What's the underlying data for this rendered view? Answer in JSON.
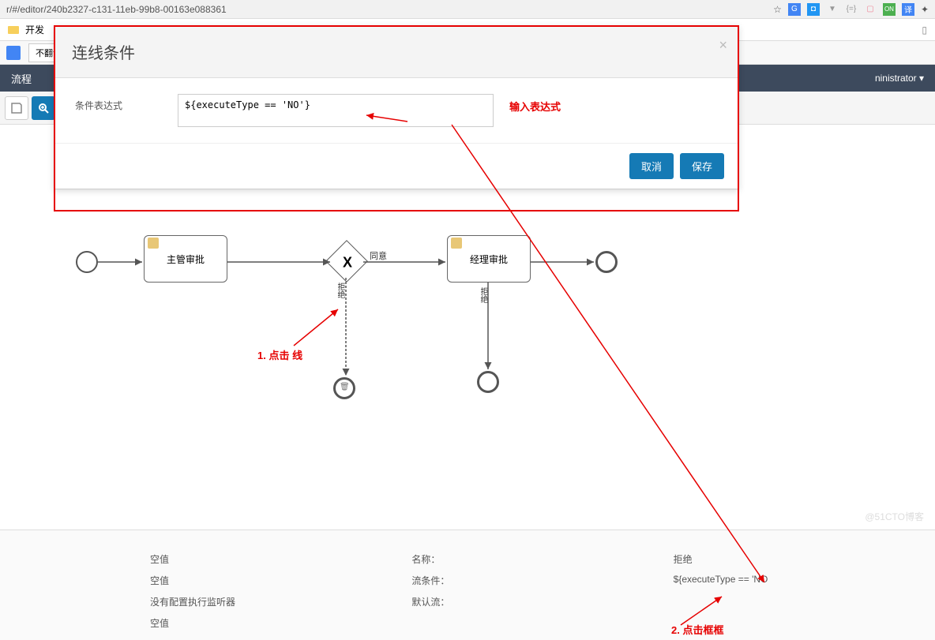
{
  "browser": {
    "url": "r/#/editor/240b2327-c131-11eb-99b8-00163e088361",
    "bookmark": "开发",
    "translate_btn": "不翻译"
  },
  "app": {
    "header_left": "流程",
    "header_right": "ninistrator ▾",
    "toolbar": {
      "tool1": "⤶",
      "tool2": "⊕"
    }
  },
  "modal": {
    "title": "连线条件",
    "label": "条件表达式",
    "expression": "${executeType == 'NO'}",
    "hint": "输入表达式",
    "cancel": "取消",
    "save": "保存"
  },
  "diagram": {
    "task1": "主管审批",
    "task2": "经理审批",
    "label_agree": "同意",
    "label_reject1": "拒绝",
    "label_reject2": "拒绝",
    "gateway_x": "X"
  },
  "annotations": {
    "step1": "1. 点击 线",
    "step2": "2. 点击框框"
  },
  "properties": {
    "left": {
      "r1": "空值",
      "r2": "空值",
      "r3": "没有配置执行监听器",
      "r4": "空值"
    },
    "mid": {
      "r1": "名称：",
      "r2": "流条件：",
      "r3": "默认流："
    },
    "right": {
      "r1": "拒绝",
      "r2": "${executeType == 'NO"
    }
  },
  "watermark": "@51CTO博客"
}
